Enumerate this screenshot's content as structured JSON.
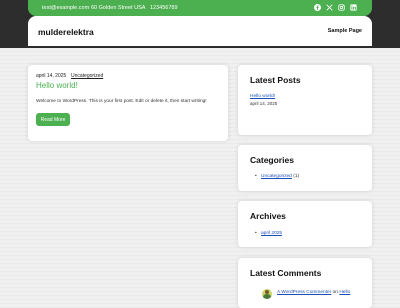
{
  "topbar": {
    "email": "test@example.com",
    "address": "60 Golden Street USA",
    "phone": "123456789"
  },
  "header": {
    "site_title": "mulderelektra",
    "nav_sample_page": "Sample Page"
  },
  "post": {
    "date": "april 14, 2025",
    "category": "Uncategorized",
    "title": "Hello world!",
    "excerpt": "Welcome to WordPress. This is your first post. Edit or delete it, then start writing!",
    "button": "Read More"
  },
  "sidebar": {
    "latest_posts": {
      "title": "Latest Posts",
      "items": [
        {
          "title": "Hello world!",
          "date": "april 14, 2025"
        }
      ]
    },
    "categories": {
      "title": "Categories",
      "items": [
        {
          "name": "Uncategorized",
          "count": "(1)"
        }
      ]
    },
    "archives": {
      "title": "Archives",
      "items": [
        {
          "name": "april 2025"
        }
      ]
    },
    "latest_comments": {
      "title": "Latest Comments",
      "items": [
        {
          "author": "A WordPress Commenter",
          "on": "on",
          "post": "Hello"
        }
      ]
    }
  },
  "colors": {
    "accent": "#4caf50",
    "dark": "#2d2d2d",
    "link": "#1a4fb8"
  },
  "icons": [
    "facebook-icon",
    "x-icon",
    "instagram-icon",
    "linkedin-icon"
  ]
}
